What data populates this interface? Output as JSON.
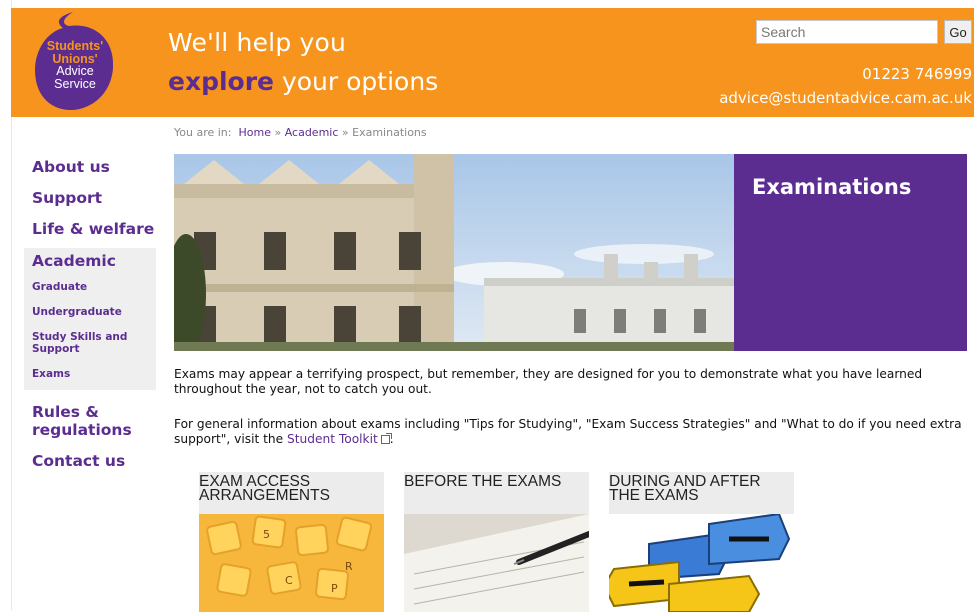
{
  "logo": {
    "line1": "Students'",
    "line2": "Unions'",
    "line3": "Advice",
    "line4": "Service"
  },
  "header": {
    "tagline_line1": "We'll help you",
    "tagline_highlight": "explore",
    "tagline_rest": " your options",
    "phone": "01223 746999",
    "email": "advice@studentadvice.cam.ac.uk"
  },
  "search": {
    "placeholder": "Search",
    "value": "",
    "button_label": "Go"
  },
  "breadcrumb": {
    "prefix": "You are in:",
    "home": "Home",
    "sep": "»",
    "parent": "Academic",
    "current": "Examinations"
  },
  "sidebar": {
    "items": [
      {
        "label": "About us"
      },
      {
        "label": "Support"
      },
      {
        "label": "Life & welfare"
      },
      {
        "label": "Academic"
      },
      {
        "label": "Rules & regulations"
      },
      {
        "label": "Contact us"
      }
    ],
    "sub_items": [
      {
        "label": "Graduate"
      },
      {
        "label": "Undergraduate"
      },
      {
        "label": "Study Skills and Support"
      },
      {
        "label": "Exams"
      }
    ]
  },
  "hero": {
    "title": "Examinations"
  },
  "content": {
    "para1": "Exams may appear a terrifying prospect, but remember, they are designed for you to demonstrate what you have learned throughout the year, not to catch you out.",
    "para2_before": "For general information about exams including \"Tips for Studying\", \"Exam Success Strategies\" and \"What to do if you need extra support\", visit the ",
    "para2_link": "Student Toolkit",
    "para2_after": "."
  },
  "cards": [
    {
      "title": "Exam Access Arrangements"
    },
    {
      "title": "Before the Exams"
    },
    {
      "title": "During and After the Exams"
    }
  ],
  "colors": {
    "header_orange": "#f7941d",
    "brand_purple": "#5c2d91",
    "sidebar_active_bg": "#efefef"
  },
  "icons": [
    "external-link-icon"
  ]
}
